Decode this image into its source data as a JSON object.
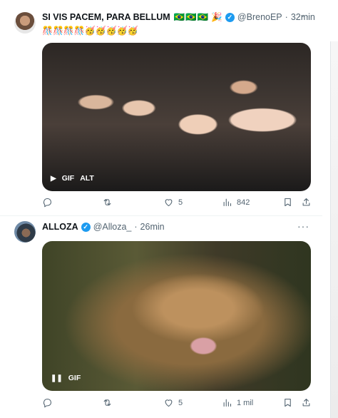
{
  "tweets": [
    {
      "display_name": "SI VIS PACEM, PARA BELLUM",
      "flags": "🇧🇷🇧🇷🇧🇷",
      "extra_emoji": "🎉",
      "handle": "@BrenoEP",
      "time": "32min",
      "text": "🎊🎊🎊🎊🥳🥳🥳🥳🥳",
      "media_badge_primary": "GIF",
      "media_badge_secondary": "ALT",
      "stats": {
        "reply": "",
        "retweet": "",
        "like": "5",
        "views": "842"
      }
    },
    {
      "display_name": "ALLOZA",
      "handle": "@Alloza_",
      "time": "26min",
      "media_badge_primary": "GIF",
      "stats": {
        "reply": "",
        "retweet": "",
        "like": "5",
        "views": "1 mil"
      }
    }
  ],
  "separator": "·",
  "more_icon": "more-icon",
  "verified_mark": "✓",
  "accent_color": "#1d9bf0"
}
